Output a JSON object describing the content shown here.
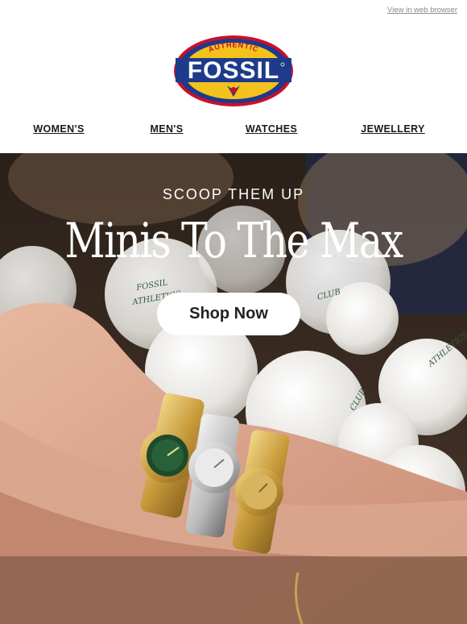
{
  "header": {
    "view_in_browser": "View in web browser",
    "logo": {
      "top_text": "AUTHENTIC",
      "brand_text": "FOSSIL",
      "colors": {
        "navy": "#1e3a8a",
        "yellow": "#f4c21d",
        "red": "#c8102e"
      }
    }
  },
  "nav": {
    "items": [
      {
        "label": "WOMEN'S"
      },
      {
        "label": "MEN'S"
      },
      {
        "label": "WATCHES"
      },
      {
        "label": "JEWELLERY"
      }
    ]
  },
  "hero": {
    "eyebrow": "SCOOP THEM UP",
    "headline": "Minis To The Max",
    "cta_label": "Shop Now",
    "ball_text": [
      "FOSSIL",
      "ATHLETICS",
      "CLUB"
    ]
  }
}
